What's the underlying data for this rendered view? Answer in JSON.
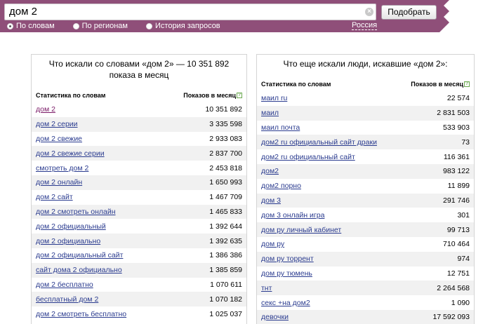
{
  "search": {
    "query": "дом 2",
    "submit_label": "Подобрать",
    "region_label": "Россия",
    "colors": {
      "bar": "#8f4f79",
      "link_visited": "#7b1a67",
      "link": "#2a3b8f"
    },
    "modes": [
      {
        "label": "По словам",
        "checked": true
      },
      {
        "label": "По регионам",
        "checked": false
      },
      {
        "label": "История запросов",
        "checked": false
      }
    ]
  },
  "left_panel": {
    "title": "Что искали со словами «дом 2» — 10 351 892 показа в месяц",
    "col_phrase": "Статистика по словам",
    "col_count": "Показов в месяц",
    "rows": [
      {
        "phrase": "дом 2",
        "count": "10 351 892"
      },
      {
        "phrase": "дом 2 серии",
        "count": "3 335 598"
      },
      {
        "phrase": "дом 2 свежие",
        "count": "2 933 083"
      },
      {
        "phrase": "дом 2 свежие серии",
        "count": "2 837 700"
      },
      {
        "phrase": "смотреть дом 2",
        "count": "2 453 818"
      },
      {
        "phrase": "дом 2 онлайн",
        "count": "1 650 993"
      },
      {
        "phrase": "дом 2 сайт",
        "count": "1 467 709"
      },
      {
        "phrase": "дом 2 смотреть онлайн",
        "count": "1 465 833"
      },
      {
        "phrase": "дом 2 официальный",
        "count": "1 392 644"
      },
      {
        "phrase": "дом 2 официально",
        "count": "1 392 635"
      },
      {
        "phrase": "дом 2 официальный сайт",
        "count": "1 386 386"
      },
      {
        "phrase": "сайт дома 2 официально",
        "count": "1 385 859"
      },
      {
        "phrase": "дом 2 бесплатно",
        "count": "1 070 611"
      },
      {
        "phrase": "бесплатный дом 2",
        "count": "1 070 182"
      },
      {
        "phrase": "дом 2 смотреть бесплатно",
        "count": "1 025 037"
      }
    ]
  },
  "right_panel": {
    "title": "Что еще искали люди, искавшие «дом 2»:",
    "col_phrase": "Статистика по словам",
    "col_count": "Показов в месяц",
    "rows": [
      {
        "phrase": "маил ru",
        "count": "22 574"
      },
      {
        "phrase": "маил",
        "count": "2 831 503"
      },
      {
        "phrase": "маил почта",
        "count": "533 903"
      },
      {
        "phrase": "дом2 ru официальный сайт драки",
        "count": "73"
      },
      {
        "phrase": "дом2 ru официальный сайт",
        "count": "116 361"
      },
      {
        "phrase": "дом2",
        "count": "983 122"
      },
      {
        "phrase": "дом2 порно",
        "count": "11 899"
      },
      {
        "phrase": "дом 3",
        "count": "291 746"
      },
      {
        "phrase": "дом 3 онлайн игра",
        "count": "301"
      },
      {
        "phrase": "дом ру личный кабинет",
        "count": "99 713"
      },
      {
        "phrase": "дом ру",
        "count": "710 464"
      },
      {
        "phrase": "дом ру торрент",
        "count": "974"
      },
      {
        "phrase": "дом ру тюмень",
        "count": "12 751"
      },
      {
        "phrase": "тнт",
        "count": "2 264 568"
      },
      {
        "phrase": "секс +на дом2",
        "count": "1 090"
      },
      {
        "phrase": "девочки",
        "count": "17 592 093"
      }
    ]
  }
}
